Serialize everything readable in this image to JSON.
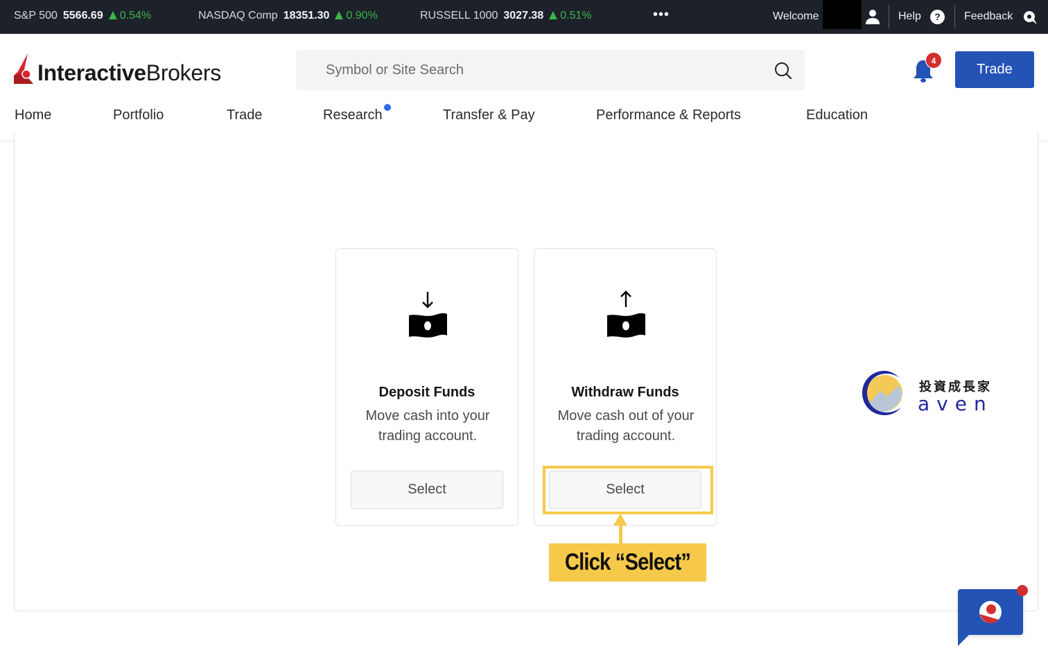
{
  "ticker": {
    "items": [
      {
        "name": "S&P 500",
        "value": "5566.69",
        "change": "0.54%"
      },
      {
        "name": "NASDAQ Comp",
        "value": "18351.30",
        "change": "0.90%"
      },
      {
        "name": "RUSSELL 1000",
        "value": "3027.38",
        "change": "0.51%"
      }
    ],
    "more": "•••",
    "welcome": "Welcome",
    "help": "Help",
    "help_icon": "?",
    "feedback": "Feedback"
  },
  "header": {
    "logo_bold": "Interactive",
    "logo_regular": "Brokers",
    "search_placeholder": "Symbol or Site Search",
    "notification_count": "4",
    "trade_button": "Trade"
  },
  "nav": {
    "items": [
      {
        "label": "Home"
      },
      {
        "label": "Portfolio"
      },
      {
        "label": "Trade"
      },
      {
        "label": "Research"
      },
      {
        "label": "Transfer & Pay"
      },
      {
        "label": "Performance & Reports"
      },
      {
        "label": "Education"
      }
    ]
  },
  "cards": [
    {
      "title": "Deposit Funds",
      "description": "Move cash into your trading account.",
      "button": "Select",
      "icon": "money-deposit-icon"
    },
    {
      "title": "Withdraw Funds",
      "description": "Move cash out of your trading account.",
      "button": "Select",
      "icon": "money-withdraw-icon"
    }
  ],
  "annotation": {
    "label": "Click “Select”"
  },
  "watermark": {
    "zh": "投資成長家",
    "en": "aven"
  },
  "colors": {
    "ticker_bg": "#1d212a",
    "positive": "#3ab54a",
    "brand_blue": "#2453b6",
    "badge_red": "#d32f2f",
    "highlight_yellow": "#f6c94a"
  }
}
